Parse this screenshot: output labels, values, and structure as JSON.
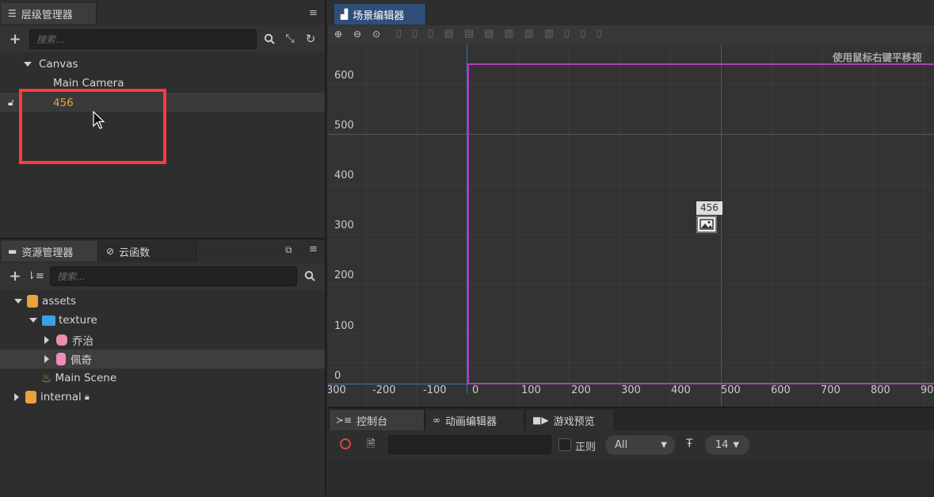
{
  "hierarchy": {
    "title": "层级管理器",
    "search_placeholder": "搜索...",
    "nodes": [
      "Canvas",
      "Main Camera",
      "456"
    ]
  },
  "assets": {
    "tabs": [
      "资源管理器",
      "云函数"
    ],
    "search_placeholder": "搜索...",
    "items": [
      "assets",
      "texture",
      "乔治",
      "佩奇",
      "Main Scene",
      "internal"
    ]
  },
  "scene": {
    "tab": "场景编辑器",
    "hint": "使用鼠标右键平移视",
    "y_ticks": [
      "600",
      "500",
      "400",
      "300",
      "200",
      "100",
      "0"
    ],
    "x_ticks": [
      "300",
      "-200",
      "-100",
      "0",
      "100",
      "200",
      "300",
      "400",
      "500",
      "600",
      "700",
      "800",
      "90"
    ],
    "node_label": "456"
  },
  "bottom": {
    "tabs": [
      "控制台",
      "动画编辑器",
      "游戏预览"
    ],
    "regex_label": "正则",
    "filter_value": "All",
    "font_size_value": "14"
  },
  "colors": {
    "highlight": "#e8a33a",
    "canvas_border": "#b13cc0",
    "annotation_box": "#ff3b3b",
    "tab_active": "#2f4f7a"
  }
}
